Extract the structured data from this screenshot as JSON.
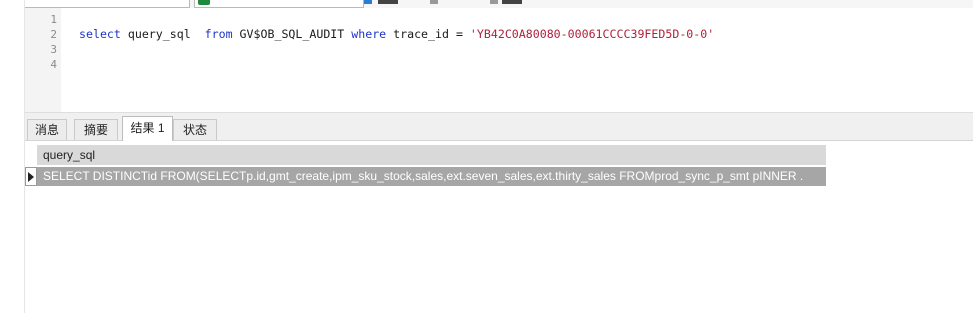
{
  "editor": {
    "line_numbers": [
      "1",
      "2",
      "3",
      "4"
    ],
    "sql": {
      "kw_select": "select",
      "t_column": " query_sql  ",
      "kw_from": "from",
      "t_table": " GV$OB_SQL_AUDIT ",
      "kw_where": "where",
      "t_cond": " trace_id = ",
      "str_value": "'YB42C0A80080-00061CCCC39FED5D-0-0'"
    }
  },
  "tabs": [
    {
      "label": "消息"
    },
    {
      "label": "摘要"
    },
    {
      "label": "结果 1"
    },
    {
      "label": "状态"
    }
  ],
  "results": {
    "columns": [
      "query_sql"
    ],
    "rows": [
      [
        "SELECT DISTINCTid FROM(SELECTp.id,gmt_create,ipm_sku_stock,sales,ext.seven_sales,ext.thirty_sales FROMprod_sync_p_smt pINNER ."
      ]
    ]
  },
  "colors": {
    "keyword": "#1f35c9",
    "string": "#b2203a",
    "selected_row": "#a6a6a6"
  }
}
